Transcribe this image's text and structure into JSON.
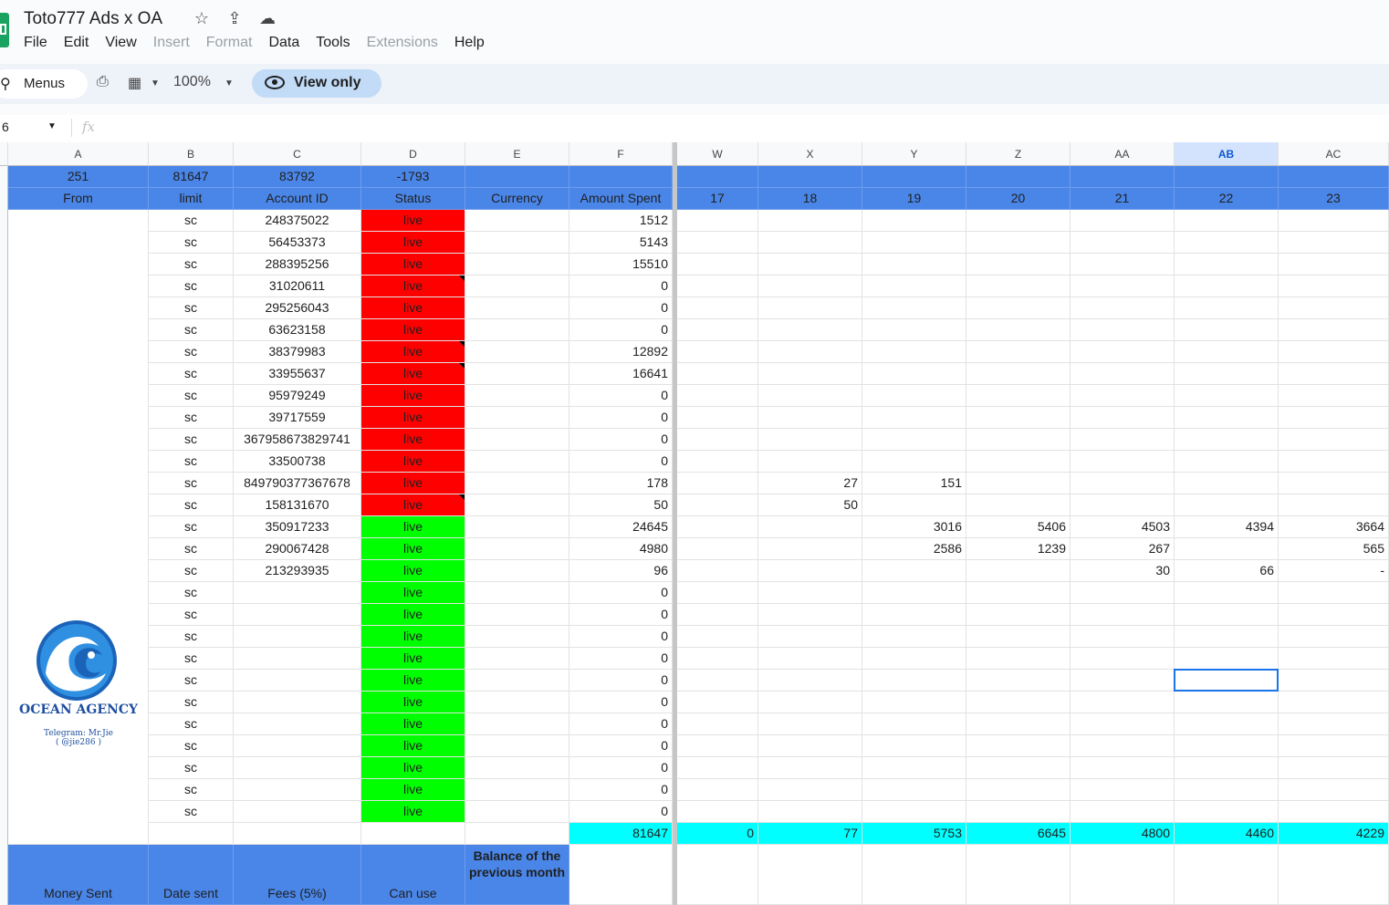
{
  "window": {
    "title": "Toto777 Ads x OA"
  },
  "menu": [
    "File",
    "Edit",
    "View",
    "Insert",
    "Format",
    "Data",
    "Tools",
    "Extensions",
    "Help"
  ],
  "menu_disabled": [
    "Insert",
    "Format",
    "Extensions"
  ],
  "toolbar": {
    "search_label": "Menus",
    "zoom": "100%",
    "view_only_label": "View only"
  },
  "formula_bar": {
    "name_box": "6",
    "fx": "fx"
  },
  "columns_left": [
    "A",
    "B",
    "C",
    "D",
    "E",
    "F"
  ],
  "columns_right": [
    "W",
    "X",
    "Y",
    "Z",
    "AA",
    "AB",
    "AC"
  ],
  "selected_column": "AB",
  "summary_row": {
    "A": "251",
    "B": "81647",
    "C": "83792",
    "D": "-1793",
    "E": "",
    "F": ""
  },
  "header_row": {
    "A": "From",
    "B": "limit",
    "C": "Account ID",
    "D": "Status",
    "E": "Currency",
    "F": "Amount Spent",
    "days": [
      "17",
      "18",
      "19",
      "20",
      "21",
      "22",
      "23"
    ]
  },
  "rows": [
    {
      "limit": "sc",
      "account": "248375022",
      "status": "live",
      "color": "red",
      "amount": "1512",
      "days": [
        "",
        "",
        "",
        "",
        "",
        "",
        ""
      ]
    },
    {
      "limit": "sc",
      "account": "56453373",
      "status": "live",
      "color": "red",
      "amount": "5143",
      "days": [
        "",
        "",
        "",
        "",
        "",
        "",
        ""
      ]
    },
    {
      "limit": "sc",
      "account": "288395256",
      "status": "live",
      "color": "red",
      "amount": "15510",
      "days": [
        "",
        "",
        "",
        "",
        "",
        "",
        ""
      ]
    },
    {
      "limit": "sc",
      "account": "31020611",
      "status": "live",
      "color": "red",
      "note": true,
      "amount": "0",
      "days": [
        "",
        "",
        "",
        "",
        "",
        "",
        ""
      ]
    },
    {
      "limit": "sc",
      "account": "295256043",
      "status": "live",
      "color": "red",
      "amount": "0",
      "days": [
        "",
        "",
        "",
        "",
        "",
        "",
        ""
      ]
    },
    {
      "limit": "sc",
      "account": "63623158",
      "status": "live",
      "color": "red",
      "amount": "0",
      "days": [
        "",
        "",
        "",
        "",
        "",
        "",
        ""
      ]
    },
    {
      "limit": "sc",
      "account": "38379983",
      "status": "live",
      "color": "red",
      "note": true,
      "amount": "12892",
      "days": [
        "",
        "",
        "",
        "",
        "",
        "",
        ""
      ]
    },
    {
      "limit": "sc",
      "account": "33955637",
      "status": "live",
      "color": "red",
      "note": true,
      "amount": "16641",
      "days": [
        "",
        "",
        "",
        "",
        "",
        "",
        ""
      ]
    },
    {
      "limit": "sc",
      "account": "95979249",
      "status": "live",
      "color": "red",
      "amount": "0",
      "days": [
        "",
        "",
        "",
        "",
        "",
        "",
        ""
      ]
    },
    {
      "limit": "sc",
      "account": "39717559",
      "status": "live",
      "color": "red",
      "amount": "0",
      "days": [
        "",
        "",
        "",
        "",
        "",
        "",
        ""
      ]
    },
    {
      "limit": "sc",
      "account": "367958673829741",
      "status": "live",
      "color": "red",
      "amount": "0",
      "days": [
        "",
        "",
        "",
        "",
        "",
        "",
        ""
      ]
    },
    {
      "limit": "sc",
      "account": "33500738",
      "status": "live",
      "color": "red",
      "amount": "0",
      "days": [
        "",
        "",
        "",
        "",
        "",
        "",
        ""
      ]
    },
    {
      "limit": "sc",
      "account": "849790377367678",
      "status": "live",
      "color": "red",
      "amount": "178",
      "days": [
        "",
        "27",
        "151",
        "",
        "",
        "",
        ""
      ]
    },
    {
      "limit": "sc",
      "account": "158131670",
      "status": "live",
      "color": "red",
      "note": true,
      "amount": "50",
      "days": [
        "",
        "50",
        "",
        "",
        "",
        "",
        ""
      ]
    },
    {
      "limit": "sc",
      "account": "350917233",
      "status": "live",
      "color": "green",
      "amount": "24645",
      "days": [
        "",
        "",
        "3016",
        "5406",
        "4503",
        "4394",
        "3664"
      ]
    },
    {
      "limit": "sc",
      "account": "290067428",
      "status": "live",
      "color": "green",
      "amount": "4980",
      "days": [
        "",
        "",
        "2586",
        "1239",
        "267",
        "",
        "565"
      ]
    },
    {
      "limit": "sc",
      "account": "213293935",
      "status": "live",
      "color": "green",
      "amount": "96",
      "days": [
        "",
        "",
        "",
        "",
        "30",
        "66",
        "-"
      ]
    },
    {
      "limit": "sc",
      "account": "",
      "status": "live",
      "color": "green",
      "amount": "0",
      "days": [
        "",
        "",
        "",
        "",
        "",
        "",
        ""
      ]
    },
    {
      "limit": "sc",
      "account": "",
      "status": "live",
      "color": "green",
      "amount": "0",
      "days": [
        "",
        "",
        "",
        "",
        "",
        "",
        ""
      ]
    },
    {
      "limit": "sc",
      "account": "",
      "status": "live",
      "color": "green",
      "amount": "0",
      "days": [
        "",
        "",
        "",
        "",
        "",
        "",
        ""
      ]
    },
    {
      "limit": "sc",
      "account": "",
      "status": "live",
      "color": "green",
      "amount": "0",
      "days": [
        "",
        "",
        "",
        "",
        "",
        "",
        ""
      ]
    },
    {
      "limit": "sc",
      "account": "",
      "status": "live",
      "color": "green",
      "amount": "0",
      "days": [
        "",
        "",
        "",
        "",
        "",
        "",
        ""
      ]
    },
    {
      "limit": "sc",
      "account": "",
      "status": "live",
      "color": "green",
      "amount": "0",
      "days": [
        "",
        "",
        "",
        "",
        "",
        "",
        ""
      ]
    },
    {
      "limit": "sc",
      "account": "",
      "status": "live",
      "color": "green",
      "amount": "0",
      "days": [
        "",
        "",
        "",
        "",
        "",
        "",
        ""
      ]
    },
    {
      "limit": "sc",
      "account": "",
      "status": "live",
      "color": "green",
      "amount": "0",
      "days": [
        "",
        "",
        "",
        "",
        "",
        "",
        ""
      ]
    },
    {
      "limit": "sc",
      "account": "",
      "status": "live",
      "color": "green",
      "amount": "0",
      "days": [
        "",
        "",
        "",
        "",
        "",
        "",
        ""
      ]
    },
    {
      "limit": "sc",
      "account": "",
      "status": "live",
      "color": "green",
      "amount": "0",
      "days": [
        "",
        "",
        "",
        "",
        "",
        "",
        ""
      ]
    },
    {
      "limit": "sc",
      "account": "",
      "status": "live",
      "color": "green",
      "amount": "0",
      "days": [
        "",
        "",
        "",
        "",
        "",
        "",
        ""
      ]
    }
  ],
  "totals_row": {
    "F": "81647",
    "days": [
      "0",
      "77",
      "5753",
      "6645",
      "4800",
      "4460",
      "4229"
    ]
  },
  "bottom_header": {
    "A": "Money Sent",
    "B": "Date sent",
    "C": "Fees (5%)",
    "D": "Can use",
    "E": "Balance of the previous month"
  },
  "logo": {
    "name": "OCEAN AGENCY",
    "telegram_line1": "Telegram: Mr.Jie",
    "telegram_line2": "( @jie286 )"
  },
  "selected_cell_row": 23,
  "colors": {
    "header_blue": "#4a86e8",
    "status_red": "#ff0000",
    "status_green": "#00ff00",
    "totals_cyan": "#00ffff",
    "selection": "#1a73e8"
  }
}
